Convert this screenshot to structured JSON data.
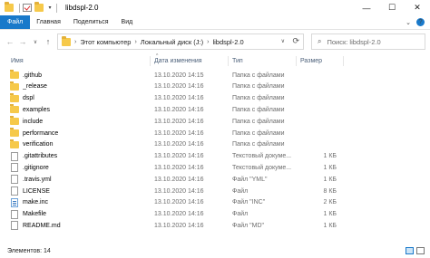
{
  "window": {
    "title": "libdspl-2.0",
    "controls": [
      "minimize",
      "maximize",
      "close"
    ]
  },
  "ribbon": {
    "tabs": [
      "Файл",
      "Главная",
      "Поделиться",
      "Вид"
    ]
  },
  "address": {
    "breadcrumbs": [
      "Этот компьютер",
      "Локальный диск (J:)",
      "libdspl-2.0"
    ]
  },
  "search": {
    "placeholder": "Поиск: libdspl-2.0"
  },
  "columns": {
    "name": "Имя",
    "date": "Дата изменения",
    "type": "Тип",
    "size": "Размер"
  },
  "files": [
    {
      "name": ".github",
      "date": "13.10.2020 14:15",
      "type": "Папка с файлами",
      "size": "",
      "icon": "folder-icon"
    },
    {
      "name": "_release",
      "date": "13.10.2020 14:16",
      "type": "Папка с файлами",
      "size": "",
      "icon": "folder-icon"
    },
    {
      "name": "dspl",
      "date": "13.10.2020 14:16",
      "type": "Папка с файлами",
      "size": "",
      "icon": "folder-icon"
    },
    {
      "name": "examples",
      "date": "13.10.2020 14:16",
      "type": "Папка с файлами",
      "size": "",
      "icon": "folder-icon"
    },
    {
      "name": "include",
      "date": "13.10.2020 14:16",
      "type": "Папка с файлами",
      "size": "",
      "icon": "folder-icon"
    },
    {
      "name": "performance",
      "date": "13.10.2020 14:16",
      "type": "Папка с файлами",
      "size": "",
      "icon": "folder-icon"
    },
    {
      "name": "verification",
      "date": "13.10.2020 14:16",
      "type": "Папка с файлами",
      "size": "",
      "icon": "folder-icon"
    },
    {
      "name": ".gitattributes",
      "date": "13.10.2020 14:16",
      "type": "Текстовый докуме...",
      "size": "1 КБ",
      "icon": "document-icon"
    },
    {
      "name": ".gitignore",
      "date": "13.10.2020 14:16",
      "type": "Текстовый докуме...",
      "size": "1 КБ",
      "icon": "document-icon"
    },
    {
      "name": ".travis.yml",
      "date": "13.10.2020 14:16",
      "type": "Файл \"YML\"",
      "size": "1 КБ",
      "icon": "document-icon"
    },
    {
      "name": "LICENSE",
      "date": "13.10.2020 14:16",
      "type": "Файл",
      "size": "8 КБ",
      "icon": "document-icon"
    },
    {
      "name": "make.inc",
      "date": "13.10.2020 14:16",
      "type": "Файл \"INC\"",
      "size": "2 КБ",
      "icon": "inc-file-icon"
    },
    {
      "name": "Makefile",
      "date": "13.10.2020 14:16",
      "type": "Файл",
      "size": "1 КБ",
      "icon": "document-icon"
    },
    {
      "name": "README.md",
      "date": "13.10.2020 14:16",
      "type": "Файл \"MD\"",
      "size": "1 КБ",
      "icon": "document-icon"
    }
  ],
  "status": {
    "items_count": "Элементов: 14"
  },
  "colors": {
    "accent": "#1979ca",
    "folder": "#f6c94a",
    "header_text": "#4c607a",
    "secondary_text": "#6d6d6d"
  }
}
